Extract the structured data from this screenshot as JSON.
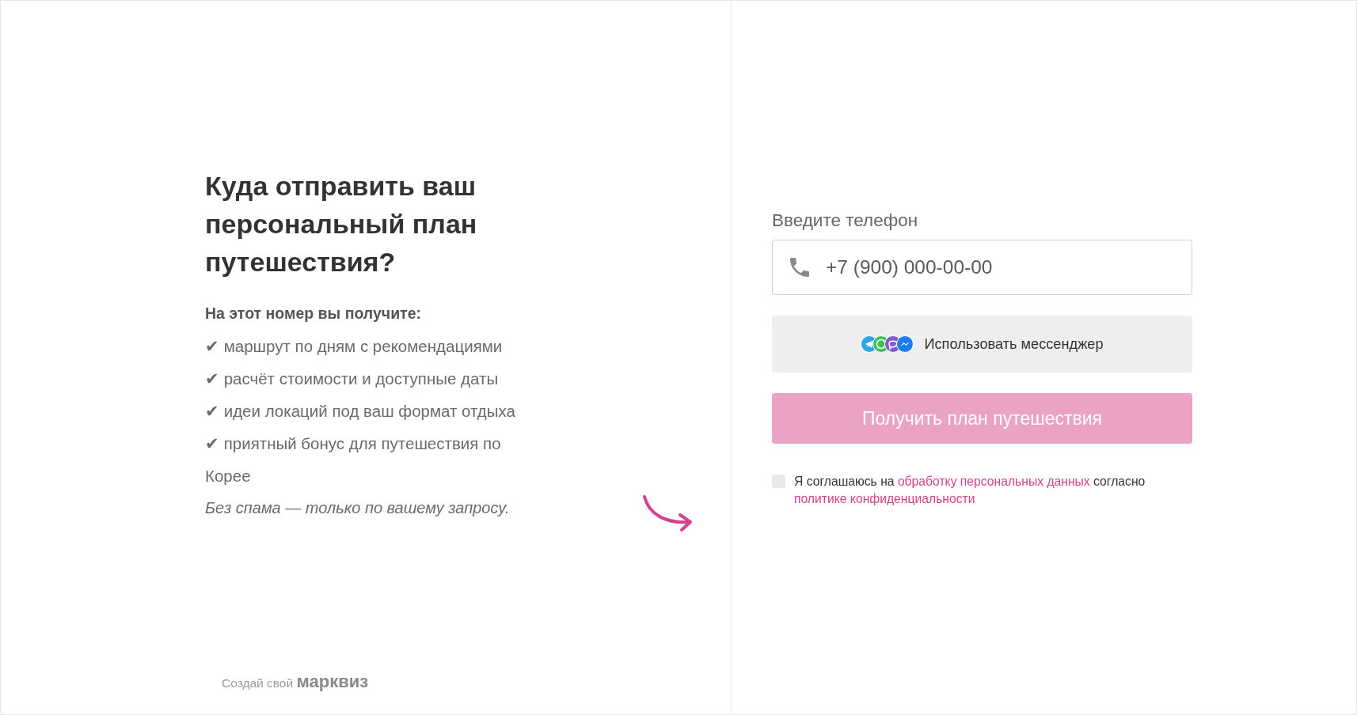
{
  "intro": {
    "title": "Куда отправить ваш персональный план путешествия?",
    "subtitle": "На этот номер вы получите:",
    "benefits": [
      "✔ маршрут по дням с рекомендациями",
      "✔ расчёт стоимости и доступные даты",
      "✔ идеи локаций под ваш формат отдыха",
      "✔ приятный бонус для путешествия по Корее"
    ],
    "note": "Без спама — только по вашему запросу."
  },
  "footer": {
    "text": "Создай свой",
    "brand": "марквиз"
  },
  "form": {
    "phone_label": "Введите телефон",
    "phone_field": {
      "placeholder": "+7 (900) 000-00-00"
    },
    "messenger_button": "Использовать мессенджер",
    "submit_button": {
      "label": "Получить план путешествия",
      "disabled": true
    },
    "consent": {
      "checked": false,
      "parts": [
        {
          "kind": "text",
          "text": "Я соглашаюсь на"
        },
        {
          "kind": "link",
          "text": "обработку персональных данных"
        },
        {
          "kind": "text",
          "text": "согласно"
        },
        {
          "kind": "link",
          "text": "политике конфиденциальности"
        }
      ]
    }
  }
}
